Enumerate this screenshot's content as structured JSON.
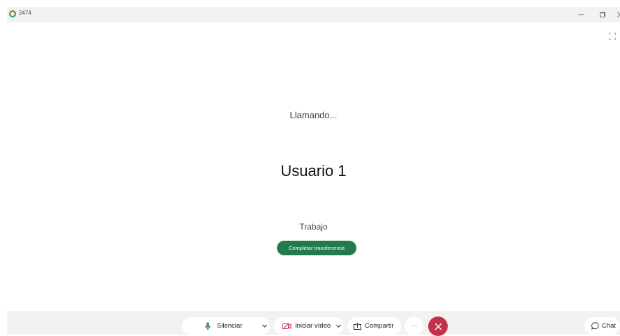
{
  "window": {
    "title": "2474",
    "controls": [
      "minimize-icon",
      "restore-icon",
      "close-icon"
    ]
  },
  "call": {
    "status": "Llamando...",
    "contact_name": "Usuario 1",
    "contact_label": "Trabajo",
    "transfer_button": "Completar transferencia"
  },
  "toolbar": {
    "mute_label": "Silenciar",
    "video_label": "Iniciar vídeo",
    "share_label": "Compartir",
    "more_label": "···",
    "chat_label": "Chat"
  },
  "colors": {
    "accent_green": "#237b4b",
    "hangup_red": "#c4314b",
    "bar_background": "#f3f2f1"
  }
}
